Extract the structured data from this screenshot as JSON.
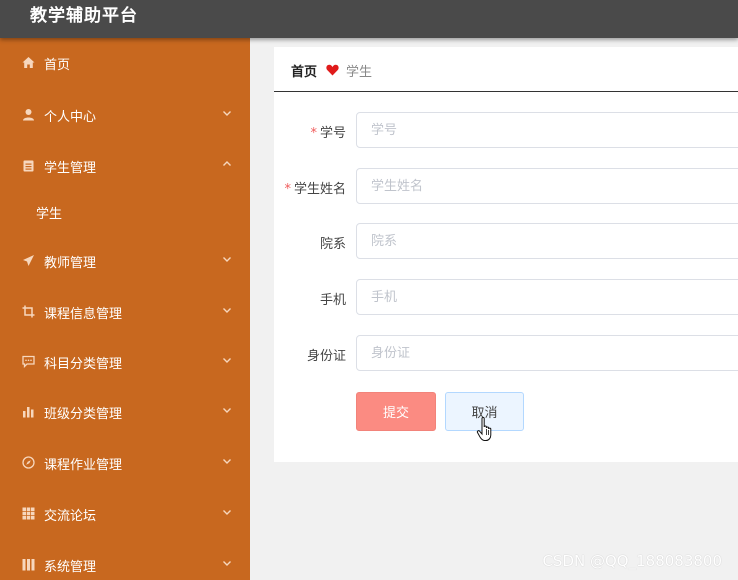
{
  "app": {
    "title": "教学辅助平台"
  },
  "sidebar": {
    "items": [
      {
        "label": "首页",
        "icon": "home-icon"
      },
      {
        "label": "个人中心",
        "icon": "user-icon",
        "chevron": "down"
      },
      {
        "label": "学生管理",
        "icon": "clipboard-icon",
        "chevron": "up",
        "expanded": true
      },
      {
        "label": "教师管理",
        "icon": "send-icon",
        "chevron": "down"
      },
      {
        "label": "课程信息管理",
        "icon": "crop-icon",
        "chevron": "down"
      },
      {
        "label": "科目分类管理",
        "icon": "message-icon",
        "chevron": "down"
      },
      {
        "label": "班级分类管理",
        "icon": "bar-chart-icon",
        "chevron": "down"
      },
      {
        "label": "课程作业管理",
        "icon": "compass-icon",
        "chevron": "down"
      },
      {
        "label": "交流论坛",
        "icon": "grid-icon",
        "chevron": "down"
      },
      {
        "label": "系统管理",
        "icon": "bars-icon",
        "chevron": "down"
      }
    ],
    "submenu": [
      {
        "label": "学生"
      }
    ]
  },
  "breadcrumb": {
    "home": "首页",
    "separator_icon": "heart-icon",
    "current": "学生"
  },
  "form": {
    "fields": [
      {
        "label": "学号",
        "placeholder": "学号",
        "value": "",
        "required": true
      },
      {
        "label": "学生姓名",
        "placeholder": "学生姓名",
        "value": "",
        "required": true
      },
      {
        "label": "院系",
        "placeholder": "院系",
        "value": "",
        "required": false
      },
      {
        "label": "手机",
        "placeholder": "手机",
        "value": "",
        "required": false
      },
      {
        "label": "身份证",
        "placeholder": "身份证",
        "value": "",
        "required": false
      }
    ],
    "required_mark": "*",
    "submit_label": "提交",
    "cancel_label": "取消"
  },
  "watermark": "CSDN @QQ_188083800",
  "colors": {
    "topbar": "#4a4a4a",
    "sidebar": "#c8681f",
    "submit": "#fb8b82",
    "cancel_bg": "#ecf5ff",
    "heart": "#e01b1b"
  }
}
